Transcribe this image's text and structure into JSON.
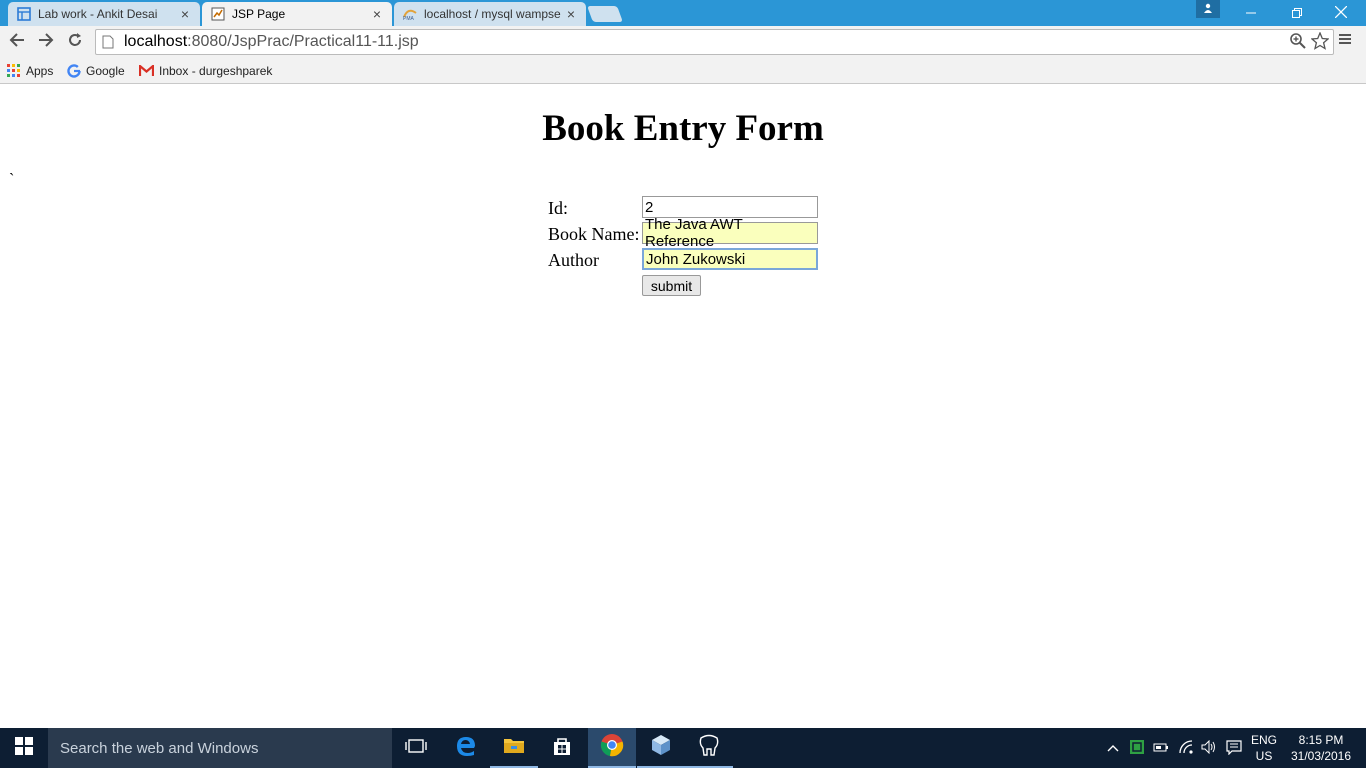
{
  "browser": {
    "tabs": [
      {
        "label": "Lab work - Ankit Desai",
        "icon": "sheets-icon"
      },
      {
        "label": "JSP Page",
        "icon": "page-icon"
      },
      {
        "label": "localhost / mysql wampse",
        "icon": "phpmyadmin-icon"
      }
    ],
    "address": {
      "host": "localhost",
      "rest": ":8080/JspPrac/Practical11-11.jsp"
    },
    "bookmarks": [
      {
        "label": "Apps",
        "icon": "apps-grid-icon"
      },
      {
        "label": "Google",
        "icon": "google-icon"
      },
      {
        "label": "Inbox - durgeshparek",
        "icon": "gmail-icon"
      }
    ]
  },
  "page": {
    "stray_char": "`",
    "title": "Book Entry Form",
    "form": {
      "id_label": "Id:",
      "id_value": "2",
      "book_label": "Book Name:",
      "book_value": "The Java AWT Reference",
      "author_label": "Author",
      "author_value": "John Zukowski",
      "submit_label": "submit"
    }
  },
  "taskbar": {
    "search_placeholder": "Search the web and Windows",
    "lang_line1": "ENG",
    "lang_line2": "US",
    "time": "8:15 PM",
    "date": "31/03/2016"
  },
  "colors": {
    "titlebar": "#2b96d6",
    "taskbar": "#0d1e33",
    "autofill": "#faffbd"
  }
}
